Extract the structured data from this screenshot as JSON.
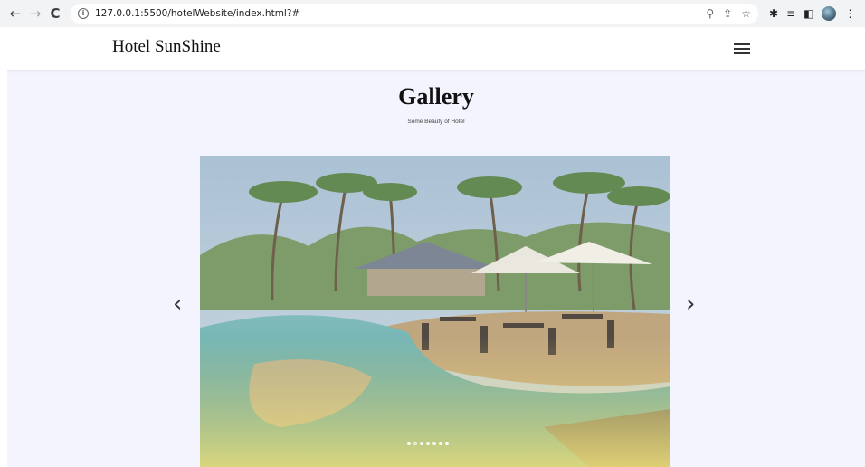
{
  "browser": {
    "url": "127.0.0.1:5500/hotelWebsite/index.html?#",
    "icons": [
      "back-icon",
      "forward-icon",
      "reload-icon",
      "info-icon",
      "zoom-icon",
      "share-icon",
      "bookmark-star-icon",
      "extensions-icon",
      "reading-list-icon",
      "side-panel-icon",
      "profile-avatar",
      "kebab-menu-icon"
    ]
  },
  "navbar": {
    "brand": "Hotel SunShine",
    "menu_icon": "hamburger-icon"
  },
  "gallery": {
    "title": "Gallery",
    "subtitle": "Some Beauty of Hotel",
    "prev_icon": "chevron-left-icon",
    "next_icon": "chevron-right-icon",
    "slide_count": 7,
    "active_slide": 1
  },
  "colors": {
    "page_bg": "#f3f4fd",
    "navbar_bg": "#ffffff",
    "chrome_bg": "#f1f3f4"
  }
}
